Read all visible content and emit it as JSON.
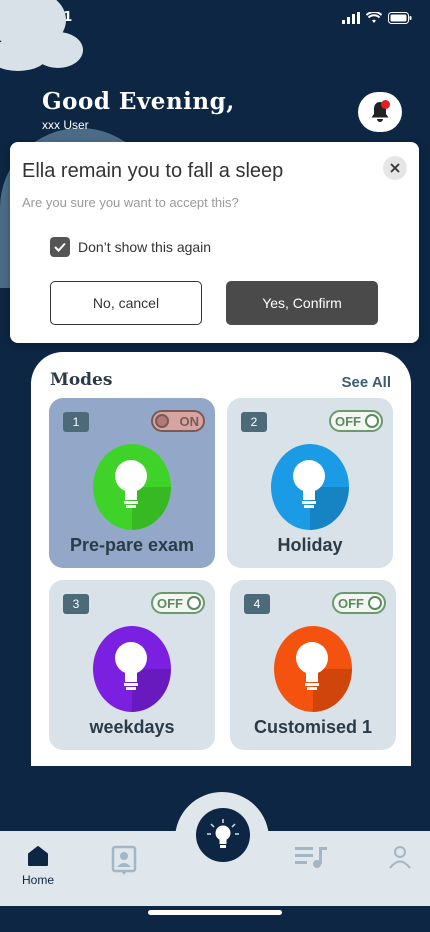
{
  "status_bar": {
    "time": "9:41"
  },
  "header": {
    "greeting": "Good Evening,",
    "username": "xxx User"
  },
  "dialog": {
    "title": "Ella remain you to fall a sleep",
    "subtitle": "Are you sure you want to accept this?",
    "checkbox_label": "Don’t show this again",
    "checkbox_checked": true,
    "cancel_label": "No, cancel",
    "confirm_label": "Yes, Confirm"
  },
  "modes": {
    "title": "Modes",
    "see_all": "See All",
    "cards": [
      {
        "number": "1",
        "toggle": "ON",
        "label": "Pre-pare exam",
        "bulb_color": "#3fd32a",
        "active": true
      },
      {
        "number": "2",
        "toggle": "OFF",
        "label": "Holiday",
        "bulb_color": "#1b9be6",
        "active": false
      },
      {
        "number": "3",
        "toggle": "OFF",
        "label": "weekdays",
        "bulb_color": "#7b1fe0",
        "active": false
      },
      {
        "number": "4",
        "toggle": "OFF",
        "label": "Customised 1",
        "bulb_color": "#f4520e",
        "active": false
      }
    ]
  },
  "nav": {
    "home_label": "Home"
  },
  "colors": {
    "background": "#0d2644",
    "panel": "#ffffff",
    "card": "#d8e2e8",
    "card_active": "#93a8c8",
    "confirm_button": "#4a4a4a"
  },
  "icons": [
    "cloud-icon",
    "signal-icon",
    "wifi-icon",
    "battery-icon",
    "bell-icon",
    "close-icon",
    "check-icon",
    "bulb-icon",
    "home-icon",
    "contact-icon",
    "playlist-icon",
    "profile-icon"
  ]
}
